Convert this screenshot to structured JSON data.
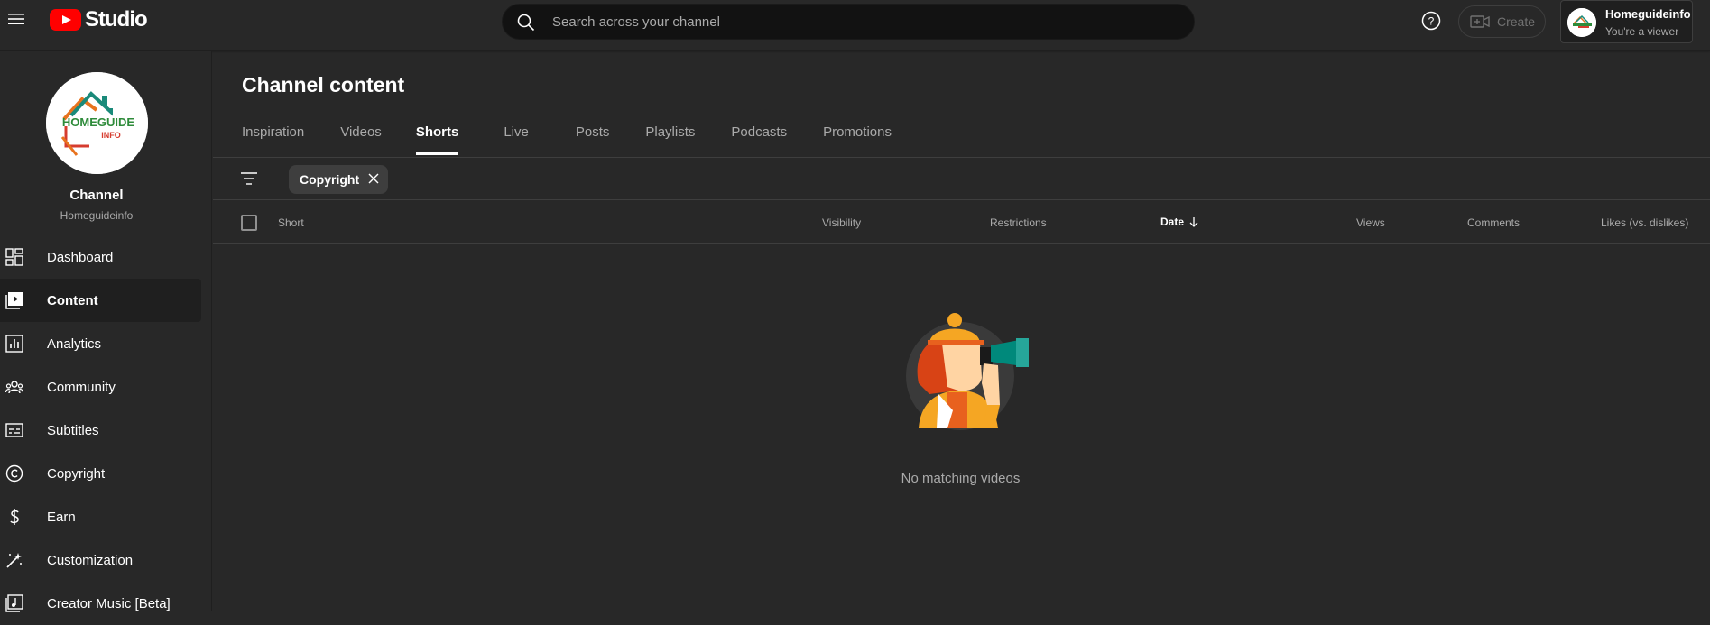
{
  "app": {
    "logo_text": "Studio"
  },
  "search": {
    "placeholder": "Search across your channel"
  },
  "header": {
    "create_label": "Create"
  },
  "account": {
    "name": "Homeguideinfo",
    "subtitle": "You're a viewer"
  },
  "channel": {
    "label": "Channel",
    "handle": "Homeguideinfo",
    "logo_text": "HOMEGUIDE",
    "logo_subtext": "INFO"
  },
  "sidebar": {
    "items": [
      {
        "label": "Dashboard",
        "icon": "dashboard-icon"
      },
      {
        "label": "Content",
        "icon": "content-icon",
        "active": true
      },
      {
        "label": "Analytics",
        "icon": "analytics-icon"
      },
      {
        "label": "Community",
        "icon": "community-icon"
      },
      {
        "label": "Subtitles",
        "icon": "subtitles-icon"
      },
      {
        "label": "Copyright",
        "icon": "copyright-icon"
      },
      {
        "label": "Earn",
        "icon": "earn-icon"
      },
      {
        "label": "Customization",
        "icon": "customization-icon"
      },
      {
        "label": "Creator Music [Beta]",
        "icon": "creator-music-icon"
      }
    ]
  },
  "main": {
    "title": "Channel content",
    "tabs": [
      {
        "label": "Inspiration"
      },
      {
        "label": "Videos"
      },
      {
        "label": "Shorts",
        "active": true
      },
      {
        "label": "Live"
      },
      {
        "label": "Posts"
      },
      {
        "label": "Playlists"
      },
      {
        "label": "Podcasts"
      },
      {
        "label": "Promotions"
      }
    ],
    "filter_chip": "Copyright",
    "columns": {
      "short": "Short",
      "visibility": "Visibility",
      "restrictions": "Restrictions",
      "date": "Date",
      "views": "Views",
      "comments": "Comments",
      "likes": "Likes (vs. dislikes)"
    },
    "empty_message": "No matching videos"
  },
  "colors": {
    "accent": "#ff0000",
    "background": "#282828",
    "muted_text": "#aaaaaa"
  }
}
